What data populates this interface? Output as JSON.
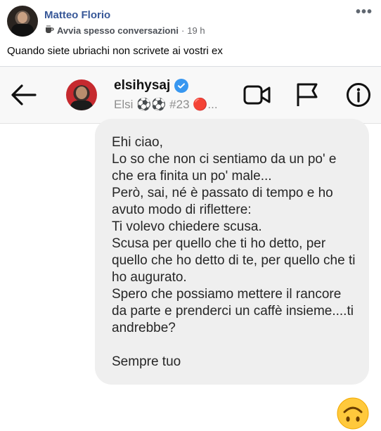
{
  "post": {
    "author": "Matteo Florio",
    "badge": "Avvia spesso conversazioni",
    "separator": "·",
    "time": "19 h",
    "more": "•••",
    "text": "Quando siete ubriachi non scrivete ai vostri ex"
  },
  "chat": {
    "username": "elsihysaj",
    "subtitle": "Elsi ⚽⚽ #23 🔴...",
    "message": "Ehi ciao,\nLo so che non ci sentiamo da un po' e che era finita un po' male...\nPerò, sai, né è passato di tempo e ho avuto modo di riflettere:\nTi volevo chiedere scusa.\nScusa per quello che ti ho detto, per quello che ho detto di te, per quello che ti ho augurato.\nSpero che possiamo mettere il rancore da parte e prenderci un caffè insieme....ti andrebbe?\n\nSempre tuo",
    "reply_emoji": "upside-down-face-icon"
  },
  "colors": {
    "author_link": "#385898",
    "bubble_bg": "#efefef",
    "verified": "#3897f0"
  }
}
